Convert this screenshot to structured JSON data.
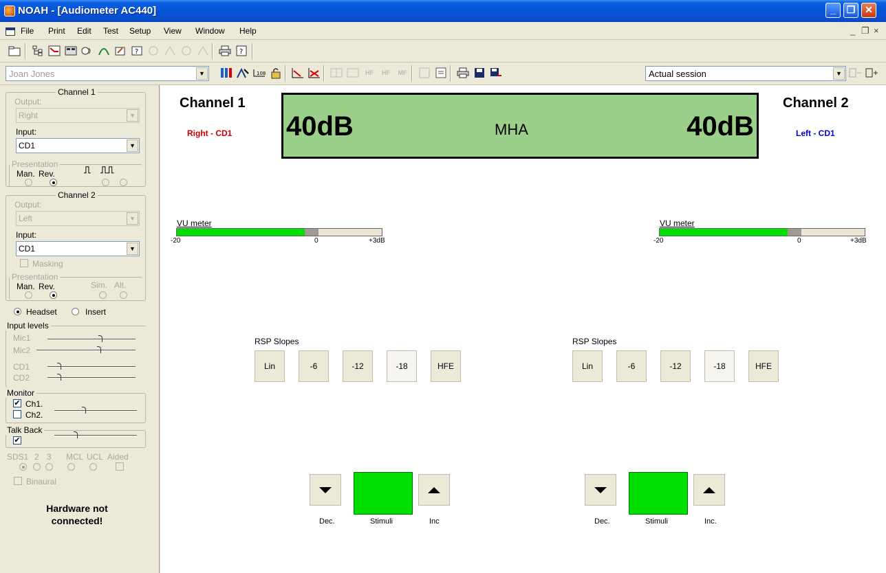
{
  "window": {
    "title": "NOAH - [Audiometer AC440]"
  },
  "menu": [
    "File",
    "Print",
    "Edit",
    "Test",
    "Setup",
    "View",
    "Window",
    "Help"
  ],
  "mdi_controls": [
    "_",
    "❐",
    "×"
  ],
  "toolbar2": {
    "patient": "Joan Jones",
    "hf_labels": [
      "HF",
      "HF",
      "MF"
    ],
    "session": "Actual session"
  },
  "left": {
    "channel1": {
      "title": "Channel 1",
      "output_label": "Output:",
      "output_value": "Right",
      "input_label": "Input:",
      "input_value": "CD1",
      "presentation": "Presentation",
      "man": "Man.",
      "rev": "Rev."
    },
    "channel2": {
      "title": "Channel 2",
      "output_label": "Output:",
      "output_value": "Left",
      "input_label": "Input:",
      "input_value": "CD1",
      "masking": "Masking",
      "presentation": "Presentation",
      "man": "Man.",
      "rev": "Rev.",
      "sim": "Sim.",
      "alt": "Alt."
    },
    "headset": "Headset",
    "insert": "Insert",
    "input_levels": {
      "title": "Input levels",
      "mic1": "Mic1",
      "mic2": "Mic2",
      "cd1": "CD1",
      "cd2": "CD2"
    },
    "monitor": {
      "title": "Monitor",
      "ch1": "Ch1.",
      "ch2": "Ch2."
    },
    "talkback": {
      "title": "Talk Back"
    },
    "sds_labels": [
      "SDS1",
      "2",
      "3",
      "MCL",
      "UCL",
      "Aided"
    ],
    "binaural": "Binaural",
    "hardware_msg_1": "Hardware not",
    "hardware_msg_2": "connected!"
  },
  "main": {
    "channel1": {
      "title": "Channel 1",
      "sub": "Right - CD1"
    },
    "channel2": {
      "title": "Channel 2",
      "sub": "Left - CD1"
    },
    "display": {
      "left": "40dB",
      "center": "MHA",
      "right": "40dB"
    },
    "vu": {
      "label": "VU meter",
      "min": "-20",
      "zero": "0",
      "max": "+3dB",
      "level_ch1": 0.76,
      "level_ch2": 0.76
    },
    "rsp_label": "RSP Slopes",
    "rsp_buttons": [
      "Lin",
      "-6",
      "-12",
      "-18",
      "HFE"
    ],
    "ctrl_ch1": {
      "dec": "Dec.",
      "stimuli": "Stimuli",
      "inc": "Inc"
    },
    "ctrl_ch2": {
      "dec": "Dec.",
      "stimuli": "Stimuli",
      "inc": "Inc."
    }
  },
  "colors": {
    "red": "#cc0000",
    "blue": "#0000cc",
    "green": "#00e000",
    "display": "#9ad08a"
  }
}
